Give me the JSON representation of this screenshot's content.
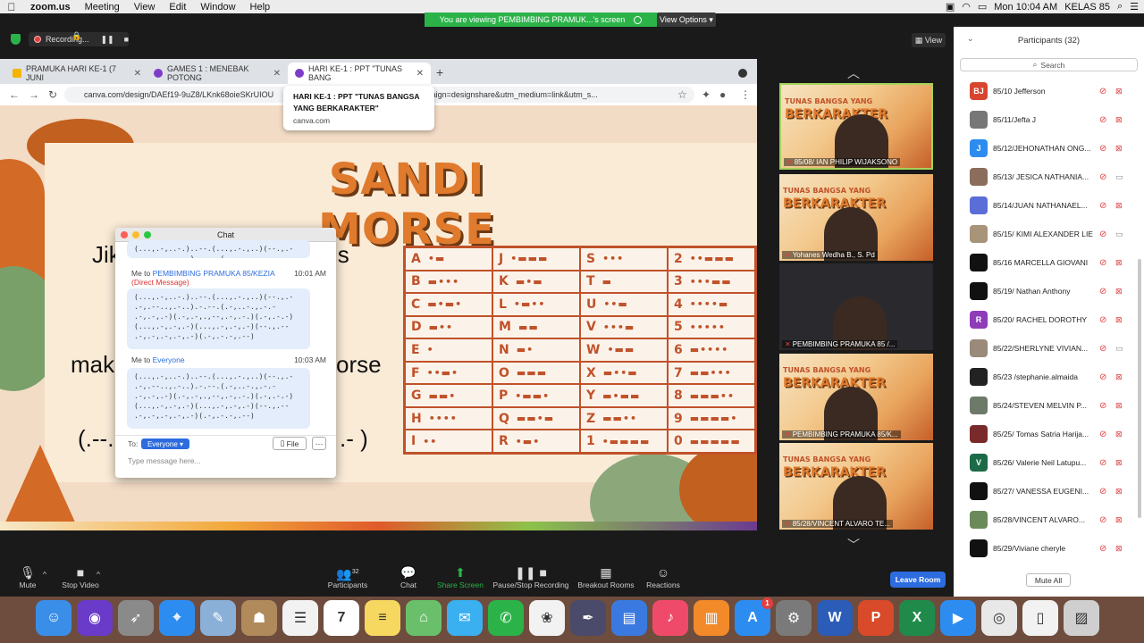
{
  "menubar": {
    "app": "zoom.us",
    "items": [
      "Meeting",
      "View",
      "Edit",
      "Window",
      "Help"
    ],
    "clock": "Mon 10:04 AM",
    "user": "KELAS 85"
  },
  "banner": {
    "text": "You are viewing PEMBIMBING PRAMUK...'s screen",
    "view_options": "View Options"
  },
  "recording": {
    "label": "Recording..."
  },
  "view_button": "View",
  "browser": {
    "tabs": [
      {
        "label": "PRAMUKA HARI KE-1 (7 JUNI",
        "icon": "drive-icon"
      },
      {
        "label": "GAMES 1 : MENEBAK POTONG",
        "icon": "canva-icon"
      },
      {
        "label": "HARI KE-1 : PPT \"TUNAS BANG",
        "icon": "canva-icon"
      }
    ],
    "url": "canva.com/design/DAEf19-9uZ8/LKnk68oieSKrUIOU",
    "url_tail": "Z8&utm_campaign=designshare&utm_medium=link&utm_s...",
    "tooltip_title": "HARI KE-1 : PPT \"TUNAS BANGSA YANG BERKARAKTER\"",
    "tooltip_domain": "canva.com"
  },
  "slide": {
    "title": "SANDI MORSE",
    "line1_left": "Jik",
    "line1_right": "is",
    "line2_left": "mak",
    "line2_right": "orse",
    "line3_left": "(.--.",
    "line3_right": ".- )",
    "morse": [
      [
        "A",
        "•▬"
      ],
      [
        "J",
        "•▬▬▬"
      ],
      [
        "S",
        "•••"
      ],
      [
        "2",
        "••▬▬▬"
      ],
      [
        "B",
        "▬•••"
      ],
      [
        "K",
        "▬•▬"
      ],
      [
        "T",
        "▬"
      ],
      [
        "3",
        "•••▬▬"
      ],
      [
        "C",
        "▬•▬•"
      ],
      [
        "L",
        "•▬••"
      ],
      [
        "U",
        "••▬"
      ],
      [
        "4",
        "••••▬"
      ],
      [
        "D",
        "▬••"
      ],
      [
        "M",
        "▬▬"
      ],
      [
        "V",
        "•••▬"
      ],
      [
        "5",
        "•••••"
      ],
      [
        "E",
        "•"
      ],
      [
        "N",
        "▬•"
      ],
      [
        "W",
        "•▬▬"
      ],
      [
        "6",
        "▬••••"
      ],
      [
        "F",
        "••▬•"
      ],
      [
        "O",
        "▬▬▬"
      ],
      [
        "X",
        "▬••▬"
      ],
      [
        "7",
        "▬▬•••"
      ],
      [
        "G",
        "▬▬•"
      ],
      [
        "P",
        "•▬▬•"
      ],
      [
        "Y",
        "▬•▬▬"
      ],
      [
        "8",
        "▬▬▬••"
      ],
      [
        "H",
        "••••"
      ],
      [
        "Q",
        "▬▬•▬"
      ],
      [
        "Z",
        "▬▬••"
      ],
      [
        "9",
        "▬▬▬▬•"
      ],
      [
        "I",
        "••"
      ],
      [
        "R",
        "•▬•"
      ],
      [
        "1",
        "•▬▬▬▬"
      ],
      [
        "0",
        "▬▬▬▬▬"
      ]
    ]
  },
  "chat": {
    "title": "Chat",
    "msg1_to_prefix": "Me to",
    "msg1_to": "PEMBIMBING PRAMUKA 85/KEZIA",
    "msg1_dm": "(Direct Message)",
    "msg1_time": "10:01 AM",
    "msg1_body": "(...,.-,..-.)..--.(...,.-.,..)(--.,.-\n.-,.--..,.-..).-.--.(.-,..-.,.-.-\n.-,.-,.-)(.-,.-,.,--,.-,.-.)(.-,.-.-)\n(...,.-,.-,.-)(...,.-,.-,.-)(--.,.--\n.-,.-,.-,.-,.-)(.-,.-.-,.--)",
    "msg2_to_prefix": "Me to",
    "msg2_to": "Everyone",
    "msg2_time": "10:03 AM",
    "msg2_body": "(...,.-,..-.)..--.(...,.-.,..)(--.,.-\n.-,.--..,.-..).-.--.(.-,..-.,.-.-\n.-,.-,.-)(.-,.-,.,--,.-,.-.)(.-,.-.-)\n(...,.-,.-,.-)(...,.-,.-,.-)(--.,.--\n.-,.-,.-,.-,.-)(.-,.-.-,.--)",
    "to_label": "To:",
    "recipient": "Everyone",
    "file_button": "File",
    "more_button": "···",
    "placeholder": "Type message here..."
  },
  "videos": [
    {
      "name": "85/08/ IAN PHILIP WIJAKSONO",
      "kind": "banner",
      "active": true
    },
    {
      "name": "Yohanes Wedha B., S. Pd",
      "kind": "banner",
      "active": false
    },
    {
      "name": "PEMBIMBING PRAMUKA 85 /...",
      "kind": "dark",
      "active": false
    },
    {
      "name": "PEMBIMBING PRAMUKA 85/K...",
      "kind": "banner",
      "active": false
    },
    {
      "name": "85/28/VINCENT ALVARO TE...",
      "kind": "banner",
      "active": false
    }
  ],
  "banner_text": {
    "small": "TUNAS BANGSA YANG",
    "big": "BERKARAKTER"
  },
  "participants": {
    "title": "Participants (32)",
    "search": "Search",
    "list": [
      {
        "name": "85/10 Jefferson",
        "initials": "BJ",
        "color": "#d8452f",
        "cam": "off"
      },
      {
        "name": "85/11/Jefta J",
        "initials": "",
        "color": "#777777",
        "cam": "off"
      },
      {
        "name": "85/12/JEHONATHAN ONG...",
        "initials": "J",
        "color": "#2d8cf0",
        "cam": "off"
      },
      {
        "name": "85/13/ JESICA NATHANIA...",
        "initials": "",
        "color": "#8a6d5a",
        "cam": "on"
      },
      {
        "name": "85/14/JUAN NATHANAEL...",
        "initials": "",
        "color": "#5b6ed8",
        "cam": "off"
      },
      {
        "name": "85/15/ KIMI ALEXANDER LIE",
        "initials": "",
        "color": "#a89478",
        "cam": "on"
      },
      {
        "name": "85/16 MARCELLA GIOVANI",
        "initials": "",
        "color": "#111111",
        "cam": "off"
      },
      {
        "name": "85/19/ Nathan Anthony",
        "initials": "",
        "color": "#111111",
        "cam": "off"
      },
      {
        "name": "85/20/ RACHEL DOROTHY",
        "initials": "R",
        "color": "#8e3cb8",
        "cam": "off"
      },
      {
        "name": "85/22/SHERLYNE VIVIAN...",
        "initials": "",
        "color": "#9a8a7a",
        "cam": "on"
      },
      {
        "name": "85/23 /stephanie.almaida",
        "initials": "",
        "color": "#222222",
        "cam": "off"
      },
      {
        "name": "85/24/STEVEN MELVIN P...",
        "initials": "",
        "color": "#6d7a6a",
        "cam": "off"
      },
      {
        "name": "85/25/ Tomas Satria Harija...",
        "initials": "",
        "color": "#7a2a2a",
        "cam": "off"
      },
      {
        "name": "85/26/ Valerie Neil Latupu...",
        "initials": "V",
        "color": "#1c6a48",
        "cam": "off"
      },
      {
        "name": "85/27/ VANESSA EUGENI...",
        "initials": "",
        "color": "#111111",
        "cam": "off"
      },
      {
        "name": "85/28/VINCENT ALVARO...",
        "initials": "",
        "color": "#6a8a5a",
        "cam": "off"
      },
      {
        "name": "85/29/Viviane cheryle",
        "initials": "",
        "color": "#111111",
        "cam": "off"
      }
    ],
    "mute_all": "Mute All"
  },
  "toolbar": {
    "mute": "Mute",
    "stop_video": "Stop Video",
    "participants": "Participants",
    "participants_count": "32",
    "chat": "Chat",
    "share_screen": "Share Screen",
    "recording": "Pause/Stop Recording",
    "breakout": "Breakout Rooms",
    "reactions": "Reactions",
    "leave": "Leave Room"
  },
  "dock": {
    "apps": [
      {
        "name": "finder",
        "color": "#3b8ee8",
        "glyph": "☺"
      },
      {
        "name": "siri",
        "color": "#6a3ac8",
        "glyph": "◉"
      },
      {
        "name": "launchpad",
        "color": "#8a8a8a",
        "glyph": "➶"
      },
      {
        "name": "safari",
        "color": "#2d8cf0",
        "glyph": "⌖"
      },
      {
        "name": "preview",
        "color": "#8ab0d8",
        "glyph": "✎"
      },
      {
        "name": "contacts",
        "color": "#b08a5a",
        "glyph": "☗"
      },
      {
        "name": "reminders",
        "color": "#f2f2f2",
        "glyph": "☰"
      },
      {
        "name": "calendar",
        "color": "#ffffff",
        "glyph": "7"
      },
      {
        "name": "notes",
        "color": "#f6d860",
        "glyph": "≡"
      },
      {
        "name": "maps",
        "color": "#6ac06a",
        "glyph": "⌂"
      },
      {
        "name": "messages",
        "color": "#3ab0f0",
        "glyph": "✉"
      },
      {
        "name": "facetime",
        "color": "#2bb34a",
        "glyph": "✆"
      },
      {
        "name": "photos",
        "color": "#f2f2f2",
        "glyph": "❀"
      },
      {
        "name": "pixelmator",
        "color": "#4a4a6a",
        "glyph": "✒"
      },
      {
        "name": "keynote",
        "color": "#3a7ae0",
        "glyph": "▤"
      },
      {
        "name": "music",
        "color": "#f04a6a",
        "glyph": "♪"
      },
      {
        "name": "books",
        "color": "#f28a2a",
        "glyph": "▥"
      },
      {
        "name": "app-store",
        "color": "#2d8cf0",
        "glyph": "A",
        "badge": "1"
      },
      {
        "name": "system-preferences",
        "color": "#7a7a7a",
        "glyph": "⚙"
      },
      {
        "name": "word",
        "color": "#2a5cb8",
        "glyph": "W"
      },
      {
        "name": "powerpoint",
        "color": "#d84a2a",
        "glyph": "P"
      },
      {
        "name": "excel",
        "color": "#1f8a4a",
        "glyph": "X"
      },
      {
        "name": "zoom",
        "color": "#2d8cf0",
        "glyph": "▶"
      },
      {
        "name": "chrome",
        "color": "#e8e8e8",
        "glyph": "◎"
      },
      {
        "name": "documents",
        "color": "#f2f2f2",
        "glyph": "▯"
      },
      {
        "name": "trash",
        "color": "#cfcfcf",
        "glyph": "▨"
      }
    ]
  }
}
